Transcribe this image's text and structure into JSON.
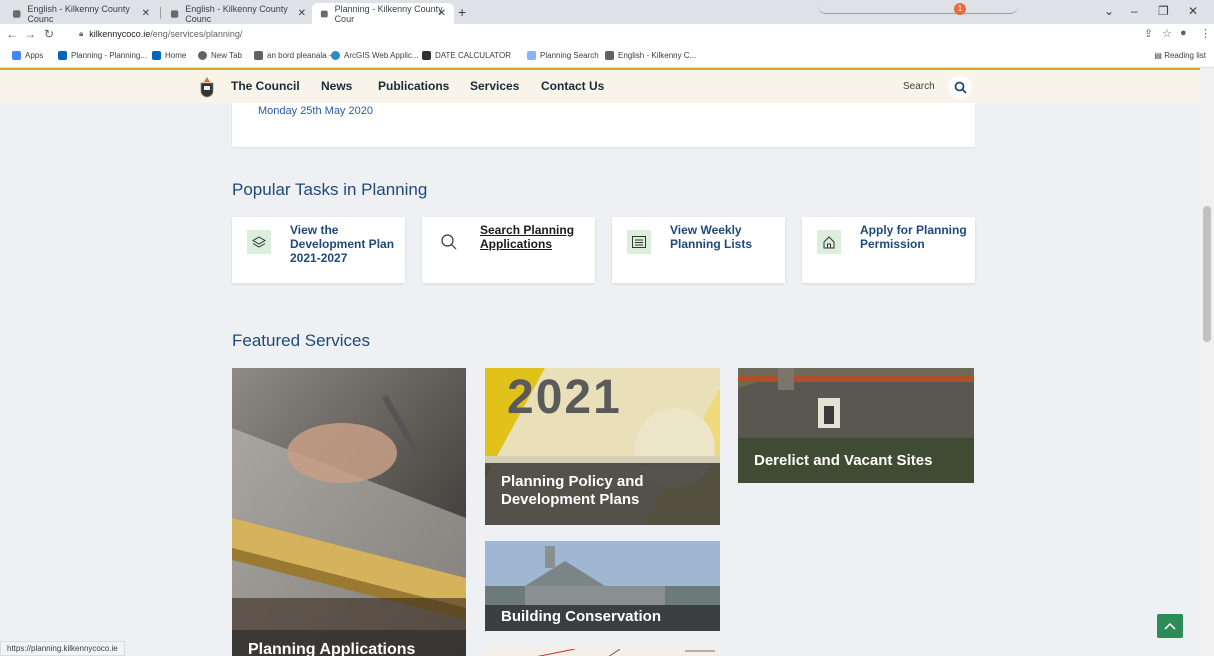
{
  "browser": {
    "tabs": [
      {
        "title": "English - Kilkenny County Counc",
        "active": false
      },
      {
        "title": "English - Kilkenny County Counc",
        "active": false
      },
      {
        "title": "Planning - Kilkenny County Cour",
        "active": true
      }
    ],
    "new_tab": "+",
    "notification_count": "1",
    "url_host": "kilkennycoco.ie",
    "url_path": "/eng/services/planning/",
    "bookmarks": [
      {
        "label": "Apps",
        "color": "#4285f4"
      },
      {
        "label": "Planning - Planning...",
        "color": "#0364b8"
      },
      {
        "label": "Home",
        "color": "#0364b8"
      },
      {
        "label": "New Tab",
        "color": "#5f6368"
      },
      {
        "label": "an bord pleanala -...",
        "color": "#5f6368"
      },
      {
        "label": "ArcGIS Web Applic...",
        "color": "#2b8cc4"
      },
      {
        "label": "DATE CALCULATOR",
        "color": "#333333"
      },
      {
        "label": "Planning Search",
        "color": "#8ab4f8"
      },
      {
        "label": "English - Kilkenny C...",
        "color": "#5f6368"
      }
    ],
    "reading_list": "Reading list",
    "status_url": "https://planning.kilkennycoco.ie"
  },
  "site": {
    "nav": [
      "The Council",
      "News",
      "Publications",
      "Services",
      "Contact Us"
    ],
    "search_label": "Search",
    "accent_color": "#e0a530"
  },
  "news": {
    "date": "Monday 25th May 2020"
  },
  "popular": {
    "title": "Popular Tasks in Planning",
    "tasks": [
      {
        "label": "View the Development Plan 2021-2027",
        "icon": "layers-icon"
      },
      {
        "label": "Search Planning Applications",
        "icon": "search-icon"
      },
      {
        "label": "View Weekly Planning Lists",
        "icon": "list-icon"
      },
      {
        "label": "Apply for Planning Permission",
        "icon": "house-icon"
      }
    ]
  },
  "featured": {
    "title": "Featured Services",
    "items": [
      {
        "label": "Planning Applications"
      },
      {
        "label": "Planning Policy and Development Plans"
      },
      {
        "label": "Derelict and Vacant Sites"
      },
      {
        "label": "Building Conservation"
      }
    ],
    "poster_digits": "2021"
  }
}
